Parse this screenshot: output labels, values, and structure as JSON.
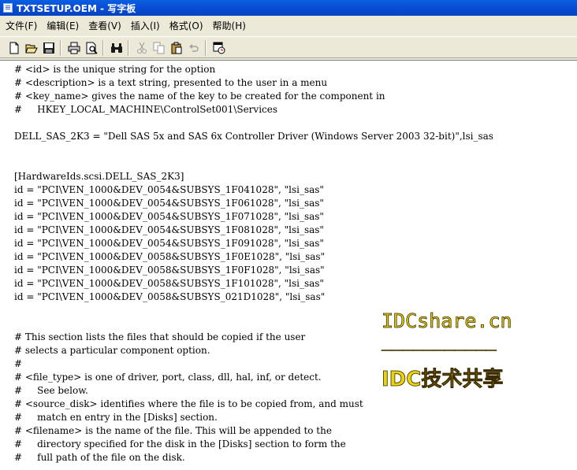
{
  "window": {
    "title": "TXTSETUP.OEM - 写字板"
  },
  "menu": {
    "items": [
      "文件(F)",
      "编辑(E)",
      "查看(V)",
      "插入(I)",
      "格式(O)",
      "帮助(H)"
    ]
  },
  "toolbar": {
    "buttons": [
      "new",
      "open",
      "save",
      "print",
      "print-preview",
      "find",
      "cut",
      "copy",
      "paste",
      "undo",
      "insert-date-time"
    ]
  },
  "document": {
    "lines": [
      "# <id> is the unique string for the option",
      "# <description> is a text string, presented to the user in a menu",
      "# <key_name> gives the name of the key to be created for the component in",
      "#     HKEY_LOCAL_MACHINE\\ControlSet001\\Services",
      "",
      "DELL_SAS_2K3 = \"Dell SAS 5x and SAS 6x Controller Driver (Windows Server 2003 32-bit)\",lsi_sas",
      "",
      "",
      "[HardwareIds.scsi.DELL_SAS_2K3]",
      "id = \"PCI\\VEN_1000&DEV_0054&SUBSYS_1F041028\", \"lsi_sas\"",
      "id = \"PCI\\VEN_1000&DEV_0054&SUBSYS_1F061028\", \"lsi_sas\"",
      "id = \"PCI\\VEN_1000&DEV_0054&SUBSYS_1F071028\", \"lsi_sas\"",
      "id = \"PCI\\VEN_1000&DEV_0054&SUBSYS_1F081028\", \"lsi_sas\"",
      "id = \"PCI\\VEN_1000&DEV_0054&SUBSYS_1F091028\", \"lsi_sas\"",
      "id = \"PCI\\VEN_1000&DEV_0058&SUBSYS_1F0E1028\", \"lsi_sas\"",
      "id = \"PCI\\VEN_1000&DEV_0058&SUBSYS_1F0F1028\", \"lsi_sas\"",
      "id = \"PCI\\VEN_1000&DEV_0058&SUBSYS_1F101028\", \"lsi_sas\"",
      "id = \"PCI\\VEN_1000&DEV_0058&SUBSYS_021D1028\", \"lsi_sas\"",
      "",
      "",
      "# This section lists the files that should be copied if the user",
      "# selects a particular component option.",
      "#",
      "# <file_type> is one of driver, port, class, dll, hal, inf, or detect.",
      "#     See below.",
      "# <source_disk> identifies where the file is to be copied from, and must",
      "#     match en entry in the [Disks] section.",
      "# <filename> is the name of the file. This will be appended to the",
      "#     directory specified for the disk in the [Disks] section to form the",
      "#     full path of the file on the disk."
    ]
  },
  "watermark": {
    "site": "IDCshare.cn",
    "rule": "___________",
    "slogan": "IDC技术共享"
  },
  "colors": {
    "titlebar": "#0A5FE0",
    "watermark": "#E8D20C"
  }
}
